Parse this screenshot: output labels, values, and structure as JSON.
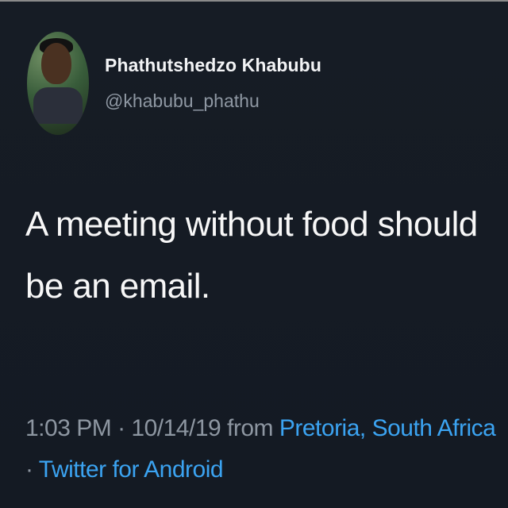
{
  "tweet": {
    "author": {
      "display_name": "Phathutshedzo Khabubu",
      "handle": "@khabubu_phathu"
    },
    "text": "A meeting without food should be an email.",
    "meta": {
      "time": "1:03 PM",
      "separator_1": " · ",
      "date": "10/14/19",
      "from_label": " from ",
      "location": "Pretoria, South Africa",
      "separator_2": " · ",
      "client": "Twitter for Android"
    }
  },
  "colors": {
    "background": "#151b24",
    "link": "#3ba3f1",
    "muted": "#8d96a1"
  }
}
